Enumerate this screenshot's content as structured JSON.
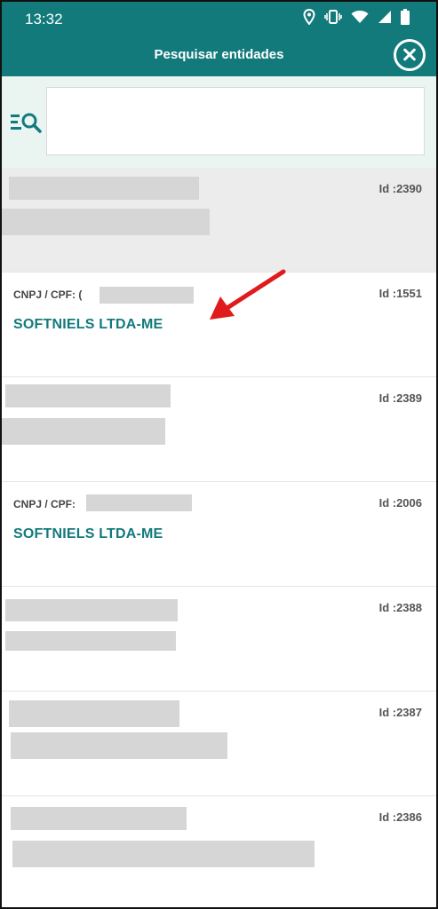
{
  "status_bar": {
    "time": "13:32"
  },
  "app_bar": {
    "title": "Pesquisar entidades"
  },
  "search": {
    "placeholder": "",
    "value": ""
  },
  "list": {
    "items": [
      {
        "id_text": "Id :2390"
      },
      {
        "cnpj_label": "CNPJ / CPF: (",
        "name": "SOFTNIELS LTDA-ME",
        "id_text": "Id :1551"
      },
      {
        "id_text": "Id :2389"
      },
      {
        "cnpj_label": "CNPJ / CPF:",
        "name": "SOFTNIELS LTDA-ME",
        "id_text": "Id :2006"
      },
      {
        "id_text": "Id :2388"
      },
      {
        "id_text": "Id :2387"
      },
      {
        "id_text": "Id :2386"
      }
    ]
  },
  "colors": {
    "primary": "#137a7c",
    "search_bg": "#eaf5f1",
    "selected_row": "#ececec",
    "redaction": "#d6d6d6",
    "annotation_arrow": "#e01b1b"
  },
  "icons": [
    "location-icon",
    "vibrate-icon",
    "wifi-icon",
    "signal-icon",
    "battery-icon",
    "close-icon",
    "filter-search-icon",
    "arrow-annotation"
  ]
}
